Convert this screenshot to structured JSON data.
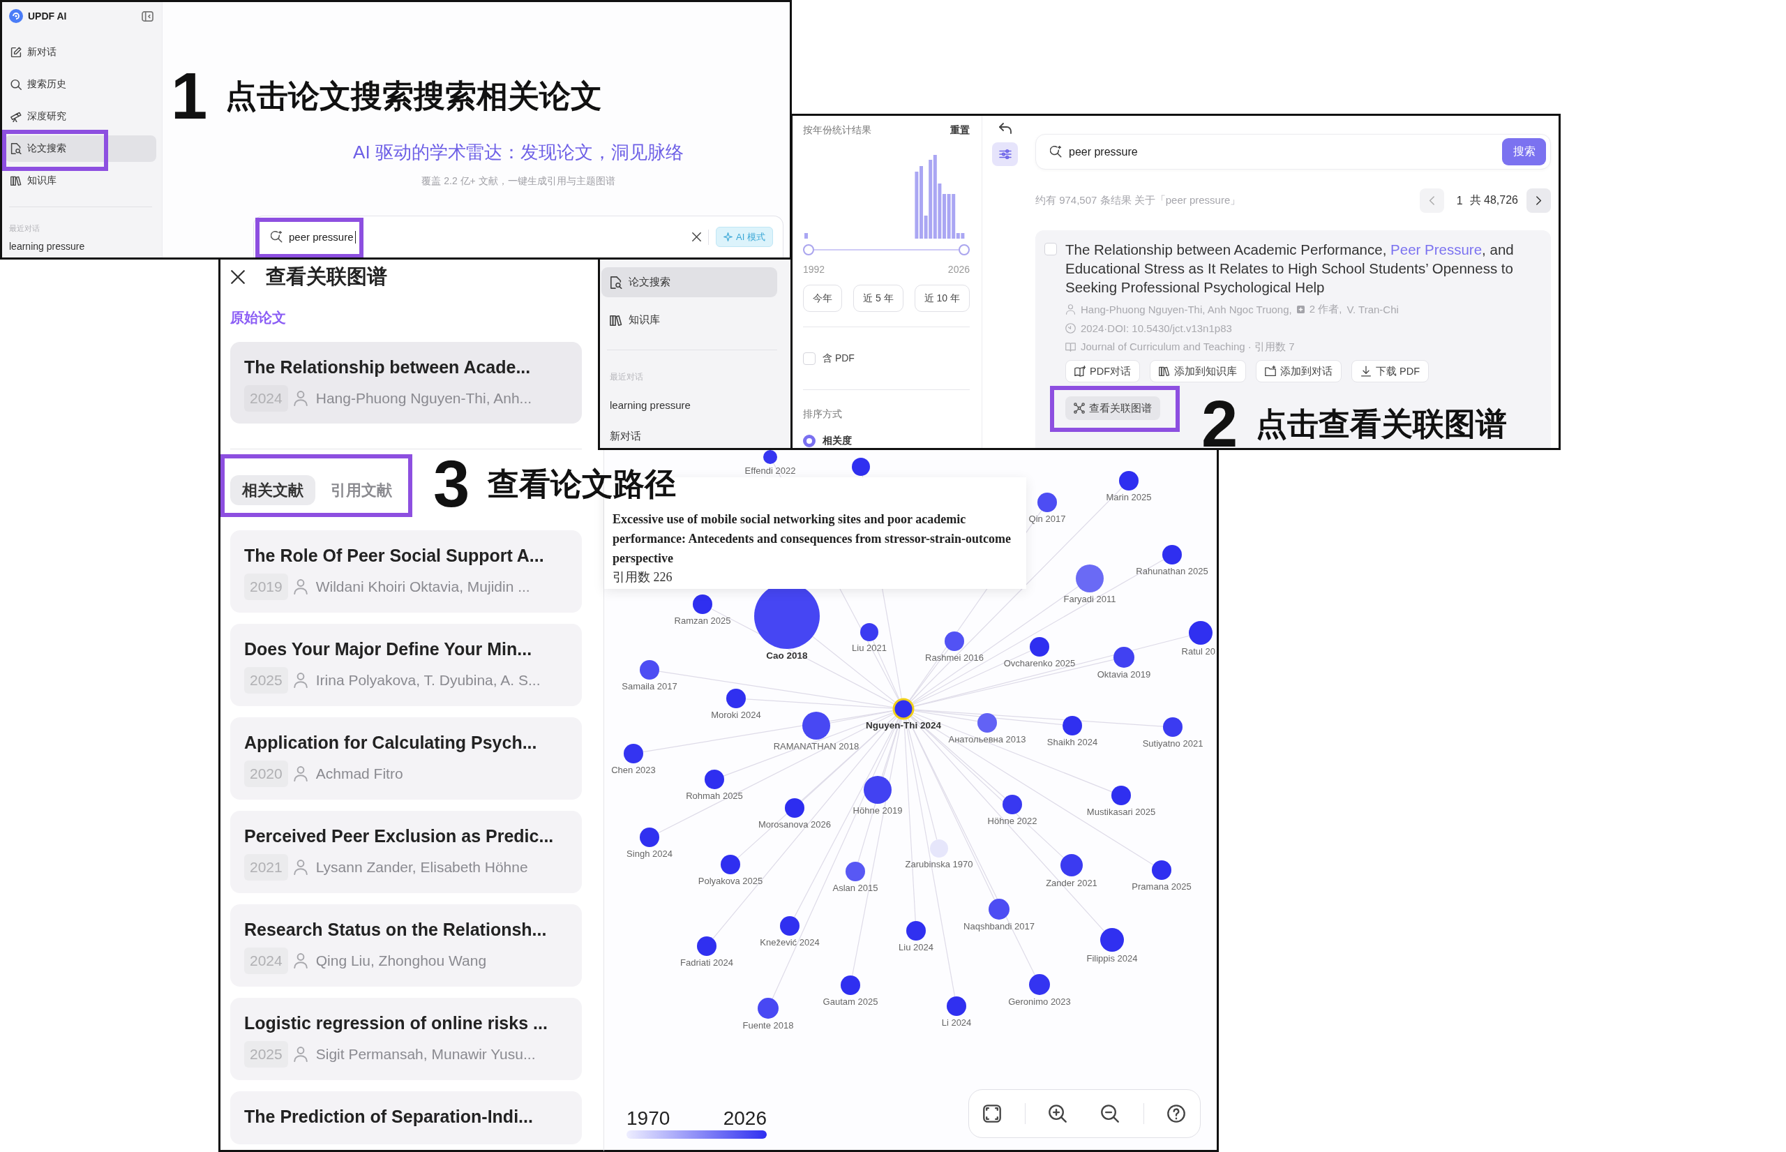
{
  "annotations": [
    {
      "number": "1",
      "text": "点击论文搜索搜索相关论文"
    },
    {
      "number": "2",
      "text": "点击查看关联图谱"
    },
    {
      "number": "3",
      "text": "查看论文路径"
    }
  ],
  "home_window": {
    "app_name": "UPDF AI",
    "nav": [
      {
        "label": "新对话",
        "kind": "chat",
        "selected": false,
        "highlighted": false
      },
      {
        "label": "搜索历史",
        "kind": "history",
        "selected": false,
        "highlighted": false
      },
      {
        "label": "深度研究",
        "kind": "research",
        "selected": false,
        "highlighted": false
      },
      {
        "label": "论文搜索",
        "kind": "papers",
        "selected": true,
        "highlighted": true
      },
      {
        "label": "知识库",
        "kind": "library",
        "selected": false,
        "highlighted": false
      }
    ],
    "section_label": "最近对话",
    "recent": [
      "learning pressure"
    ],
    "tagline": "AI 驱动的学术雷达：发现论文，洞见脉络",
    "subtitle": "覆盖 2.2 亿+ 文献，一键生成引用与主题图谱",
    "search": {
      "value": "peer pressure",
      "highlighted": true
    },
    "mode_button": "AI 模式"
  },
  "results_window": {
    "nav": [
      {
        "label": "论文搜索",
        "kind": "papers",
        "selected": true
      },
      {
        "label": "知识库",
        "kind": "library",
        "selected": false
      }
    ],
    "section_label": "最近对话",
    "recent": [
      "learning pressure",
      "新对话"
    ],
    "filter": {
      "title": "按年份统计结果",
      "reset": "重置",
      "year_slider": {
        "handles": [
          {
            "level": 0
          },
          {
            "level": 1
          }
        ]
      },
      "year_start": "1992",
      "year_end": "2026",
      "quick_ranges": [
        "今年",
        "近 5 年",
        "近 10 年"
      ],
      "pdf": {
        "label": "含 PDF",
        "checked": false
      },
      "sort_title": "排序方式",
      "sort_options": [
        {
          "label": "相关度",
          "selected": true
        }
      ]
    },
    "filter_toggle": {
      "selected": true
    },
    "search": {
      "value": "peer pressure",
      "button": "搜索"
    },
    "summary": "约有 974,507 条结果 关于「peer pressure」",
    "pagination": {
      "page": "1",
      "total": "共 48,726"
    },
    "paper": {
      "checked": false,
      "title": [
        {
          "text": "The Relationship between Academic Performance, ",
          "match": false
        },
        {
          "text": "Peer Pressure",
          "match": true
        },
        {
          "text": ", and Educational Stress as It Relates to High School Students’ Openness to Seeking Professional Psychological Help",
          "match": false
        }
      ],
      "authors": "Hang-Phuong Nguyen-Thi, Anh Ngoc Truong,",
      "more_authors": "2 作者,",
      "last_author": "V. Tran-Chi",
      "date_doi": "2024·DOI: 10.5430/jct.v13n1p83",
      "journal": "Journal of Curriculum and Teaching · 引用数 7",
      "actions": [
        {
          "label": "PDF对话",
          "kind": "pdfchat"
        },
        {
          "label": "添加到知识库",
          "kind": "library"
        },
        {
          "label": "添加到对话",
          "kind": "attach"
        },
        {
          "label": "下载 PDF",
          "kind": "download"
        }
      ],
      "graph_button": {
        "label": "查看关联图谱",
        "highlighted": true
      }
    }
  },
  "graph_view": {
    "title": "查看关联图谱",
    "origin_label": "原始论文",
    "origin_paper": {
      "title": "The Relationship between Acade...",
      "year": "2024",
      "authors": "Hang-Phuong Nguyen-Thi, Anh..."
    },
    "tabs": [
      {
        "label": "相关文献",
        "selected": true
      },
      {
        "label": "引用文献",
        "selected": false
      }
    ],
    "tabs_highlighted": true,
    "papers": [
      {
        "title": "The Role Of Peer Social Support A...",
        "year": "2019",
        "authors": "Wildani Khoiri Oktavia, Mujidin ..."
      },
      {
        "title": "Does Your Major Define Your Min...",
        "year": "2025",
        "authors": "Irina Polyakova, T. Dyubina, A. S..."
      },
      {
        "title": "Application for Calculating Psych...",
        "year": "2020",
        "authors": "Achmad Fitro"
      },
      {
        "title": "Perceived Peer Exclusion as Predic...",
        "year": "2021",
        "authors": "Lysann Zander, Elisabeth Höhne"
      },
      {
        "title": "Research Status on the Relationsh...",
        "year": "2024",
        "authors": "Qing Liu, Zhonghou Wang"
      },
      {
        "title": "Logistic regression of online risks ...",
        "year": "2025",
        "authors": "Sigit Permansah, Munawir Yusu..."
      },
      {
        "title": "The Prediction of Separation-Indi..."
      }
    ],
    "graph": {
      "nodes": [
        {
          "label": "Effendi 2022",
          "color": "#3535f1",
          "kind": "paper"
        },
        {
          "color": "#3030f0",
          "kind": "paper"
        },
        {
          "label": "Marin 2025",
          "color": "#2f2ff0",
          "kind": "paper"
        },
        {
          "label": "Qin 2017",
          "color": "#4d4df3",
          "kind": "paper"
        },
        {
          "label": "Rahunathan 2025",
          "color": "#2f2ff0",
          "kind": "paper"
        },
        {
          "label": "Faryadi 2011",
          "color": "#6a6af5",
          "kind": "paper"
        },
        {
          "label": "Ramzan 2025",
          "color": "#2f2ff0",
          "kind": "paper"
        },
        {
          "label": "Cao 2018",
          "color": "#4646f3",
          "kind": "hovered"
        },
        {
          "label": "Liu 2021",
          "color": "#3b3bf1",
          "kind": "paper"
        },
        {
          "label": "Rashmei 2016",
          "color": "#5252f4",
          "kind": "paper"
        },
        {
          "label": "Ovcharenko 2025",
          "color": "#2f2ff0",
          "kind": "paper"
        },
        {
          "label": "Oktavia 2019",
          "color": "#4141f2",
          "kind": "paper"
        },
        {
          "label": "Ratul 20",
          "color": "#3030f0",
          "kind": "paper"
        },
        {
          "label": "Samaila 2017",
          "color": "#4d4df3",
          "kind": "paper"
        },
        {
          "label": "Moroki 2024",
          "color": "#3030f0",
          "kind": "paper"
        },
        {
          "label": "Nguyen-Thi 2024",
          "color": "#3030f0",
          "kind": "origin"
        },
        {
          "label": "RAMANATHAN 2018",
          "color": "#4848f3",
          "kind": "paper"
        },
        {
          "label": "Анатольевна 2013",
          "color": "#6262f5",
          "kind": "paper"
        },
        {
          "label": "Shaikh 2024",
          "color": "#3030f0",
          "kind": "paper"
        },
        {
          "label": "Sutiyatno 2021",
          "color": "#3b3bf1",
          "kind": "paper"
        },
        {
          "label": "Chen 2023",
          "color": "#3434f1",
          "kind": "paper"
        },
        {
          "label": "Rohmah 2025",
          "color": "#2f2ff0",
          "kind": "paper"
        },
        {
          "label": "Morosanova 2026",
          "color": "#2d2df0",
          "kind": "paper"
        },
        {
          "label": "Höhne 2019",
          "color": "#4242f2",
          "kind": "paper"
        },
        {
          "label": "Höhne 2022",
          "color": "#3838f1",
          "kind": "paper"
        },
        {
          "label": "Mustikasari 2025",
          "color": "#2f2ff0",
          "kind": "paper"
        },
        {
          "label": "Singh 2024",
          "color": "#3030f0",
          "kind": "paper"
        },
        {
          "label": "Zarubinska 1970",
          "color": "#e6e6fb",
          "kind": "paper"
        },
        {
          "label": "Polyakova 2025",
          "color": "#2f2ff0",
          "kind": "paper"
        },
        {
          "label": "Aslan 2015",
          "color": "#5858f4",
          "kind": "paper"
        },
        {
          "label": "Zander 2021",
          "color": "#3b3bf1",
          "kind": "paper"
        },
        {
          "label": "Pramana 2025",
          "color": "#2f2ff0",
          "kind": "paper"
        },
        {
          "label": "Naqshbandi 2017",
          "color": "#4d4df3",
          "kind": "paper"
        },
        {
          "label": "Knežević 2024",
          "color": "#3030f0",
          "kind": "paper"
        },
        {
          "label": "Liu 2024",
          "color": "#3030f0",
          "kind": "paper"
        },
        {
          "label": "Fadriati 2024",
          "color": "#3030f0",
          "kind": "paper"
        },
        {
          "label": "Filippis 2024",
          "color": "#3030f0",
          "kind": "paper"
        },
        {
          "label": "Gautam 2025",
          "color": "#2f2ff0",
          "kind": "paper"
        },
        {
          "label": "Geronimo 2023",
          "color": "#3434f1",
          "kind": "paper"
        },
        {
          "label": "Fuente 2018",
          "color": "#4848f3",
          "kind": "paper"
        },
        {
          "label": "Li 2024",
          "color": "#3030f0",
          "kind": "paper"
        }
      ],
      "tooltip": {
        "title": "Excessive use of mobile social networking sites and poor academic performance: Antecedents and consequences from stressor-strain-outcome perspective",
        "citations": "引用数 226"
      },
      "legend": {
        "start": "1970",
        "end": "2026"
      }
    }
  }
}
